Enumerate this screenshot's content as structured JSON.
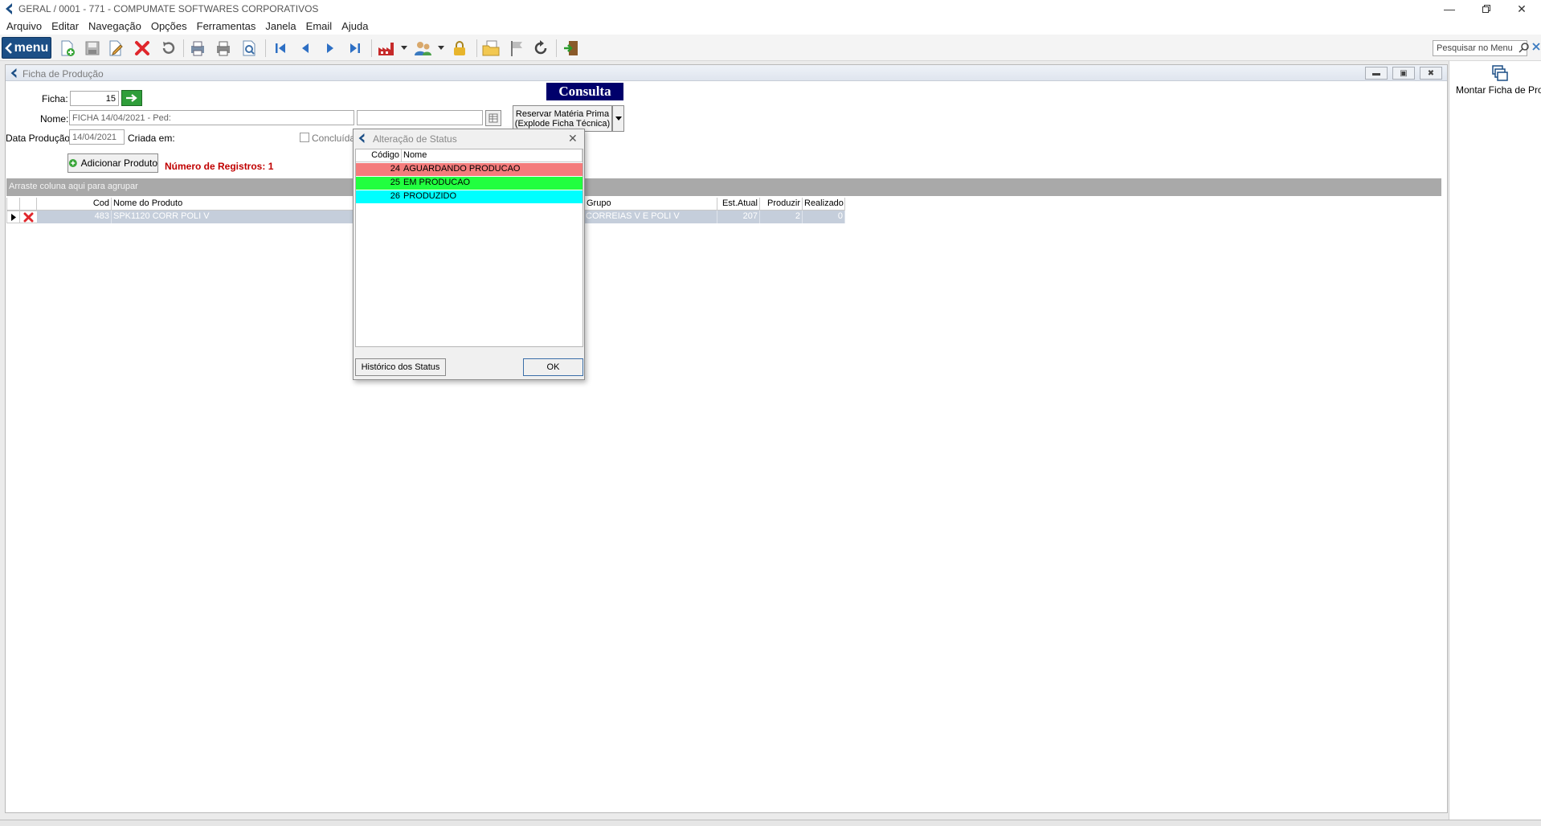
{
  "window": {
    "title": "GERAL / 0001 - 771 - COMPUMATE SOFTWARES CORPORATIVOS"
  },
  "menubar": [
    "Arquivo",
    "Editar",
    "Navegação",
    "Opções",
    "Ferramentas",
    "Janela",
    "Email",
    "Ajuda"
  ],
  "toolbar": {
    "menu_label": "menu",
    "search_placeholder": "Pesquisar no Menu"
  },
  "child": {
    "title": "Ficha de Produção",
    "ficha_label": "Ficha:",
    "ficha_value": "15",
    "nome_label": "Nome:",
    "nome_value": "FICHA 14/04/2021 - Ped:",
    "data_label": "Data Produção:",
    "data_value": "14/04/2021",
    "criada_label": "Criada em:",
    "concluida_label": "Concluída",
    "consulta": "Consulta",
    "reservar_line1": "Reservar Matéria Prima",
    "reservar_line2": "(Explode Ficha Técnica)",
    "adicionar_label": "Adicionar Produto",
    "registros": "Número de Registros: 1",
    "groupbar": "Arraste coluna aqui para agrupar",
    "grid": {
      "headers": {
        "cod": "Cod",
        "nome": "Nome do Produto",
        "grupo": "Grupo",
        "est": "Est.Atual",
        "produzir": "Produzir",
        "realizado": "Realizado"
      },
      "row": {
        "cod": "483",
        "nome": "SPK1120 CORR POLI V",
        "grupo": "CORREIAS V E POLI V",
        "est": "207",
        "produzir": "2",
        "realizado": "0"
      }
    }
  },
  "rightpanel": {
    "label": "Montar Ficha de Pro"
  },
  "dialog": {
    "title": "Alteração de Status",
    "headers": {
      "codigo": "Código",
      "nome": "Nome"
    },
    "rows": [
      {
        "codigo": "24",
        "nome": "AGUARDANDO PRODUCAO",
        "color": "#f47c7c"
      },
      {
        "codigo": "25",
        "nome": "EM PRODUCAO",
        "color": "#21ff3f"
      },
      {
        "codigo": "26",
        "nome": "PRODUZIDO",
        "color": "#00ffff"
      }
    ],
    "historico_label": "Histórico dos Status",
    "ok_label": "OK"
  },
  "colors": {
    "menu_button": "#1c4f86",
    "consulta_bg": "#00006b",
    "registros_text": "#c00000",
    "selected_row": "#c5cedb"
  }
}
